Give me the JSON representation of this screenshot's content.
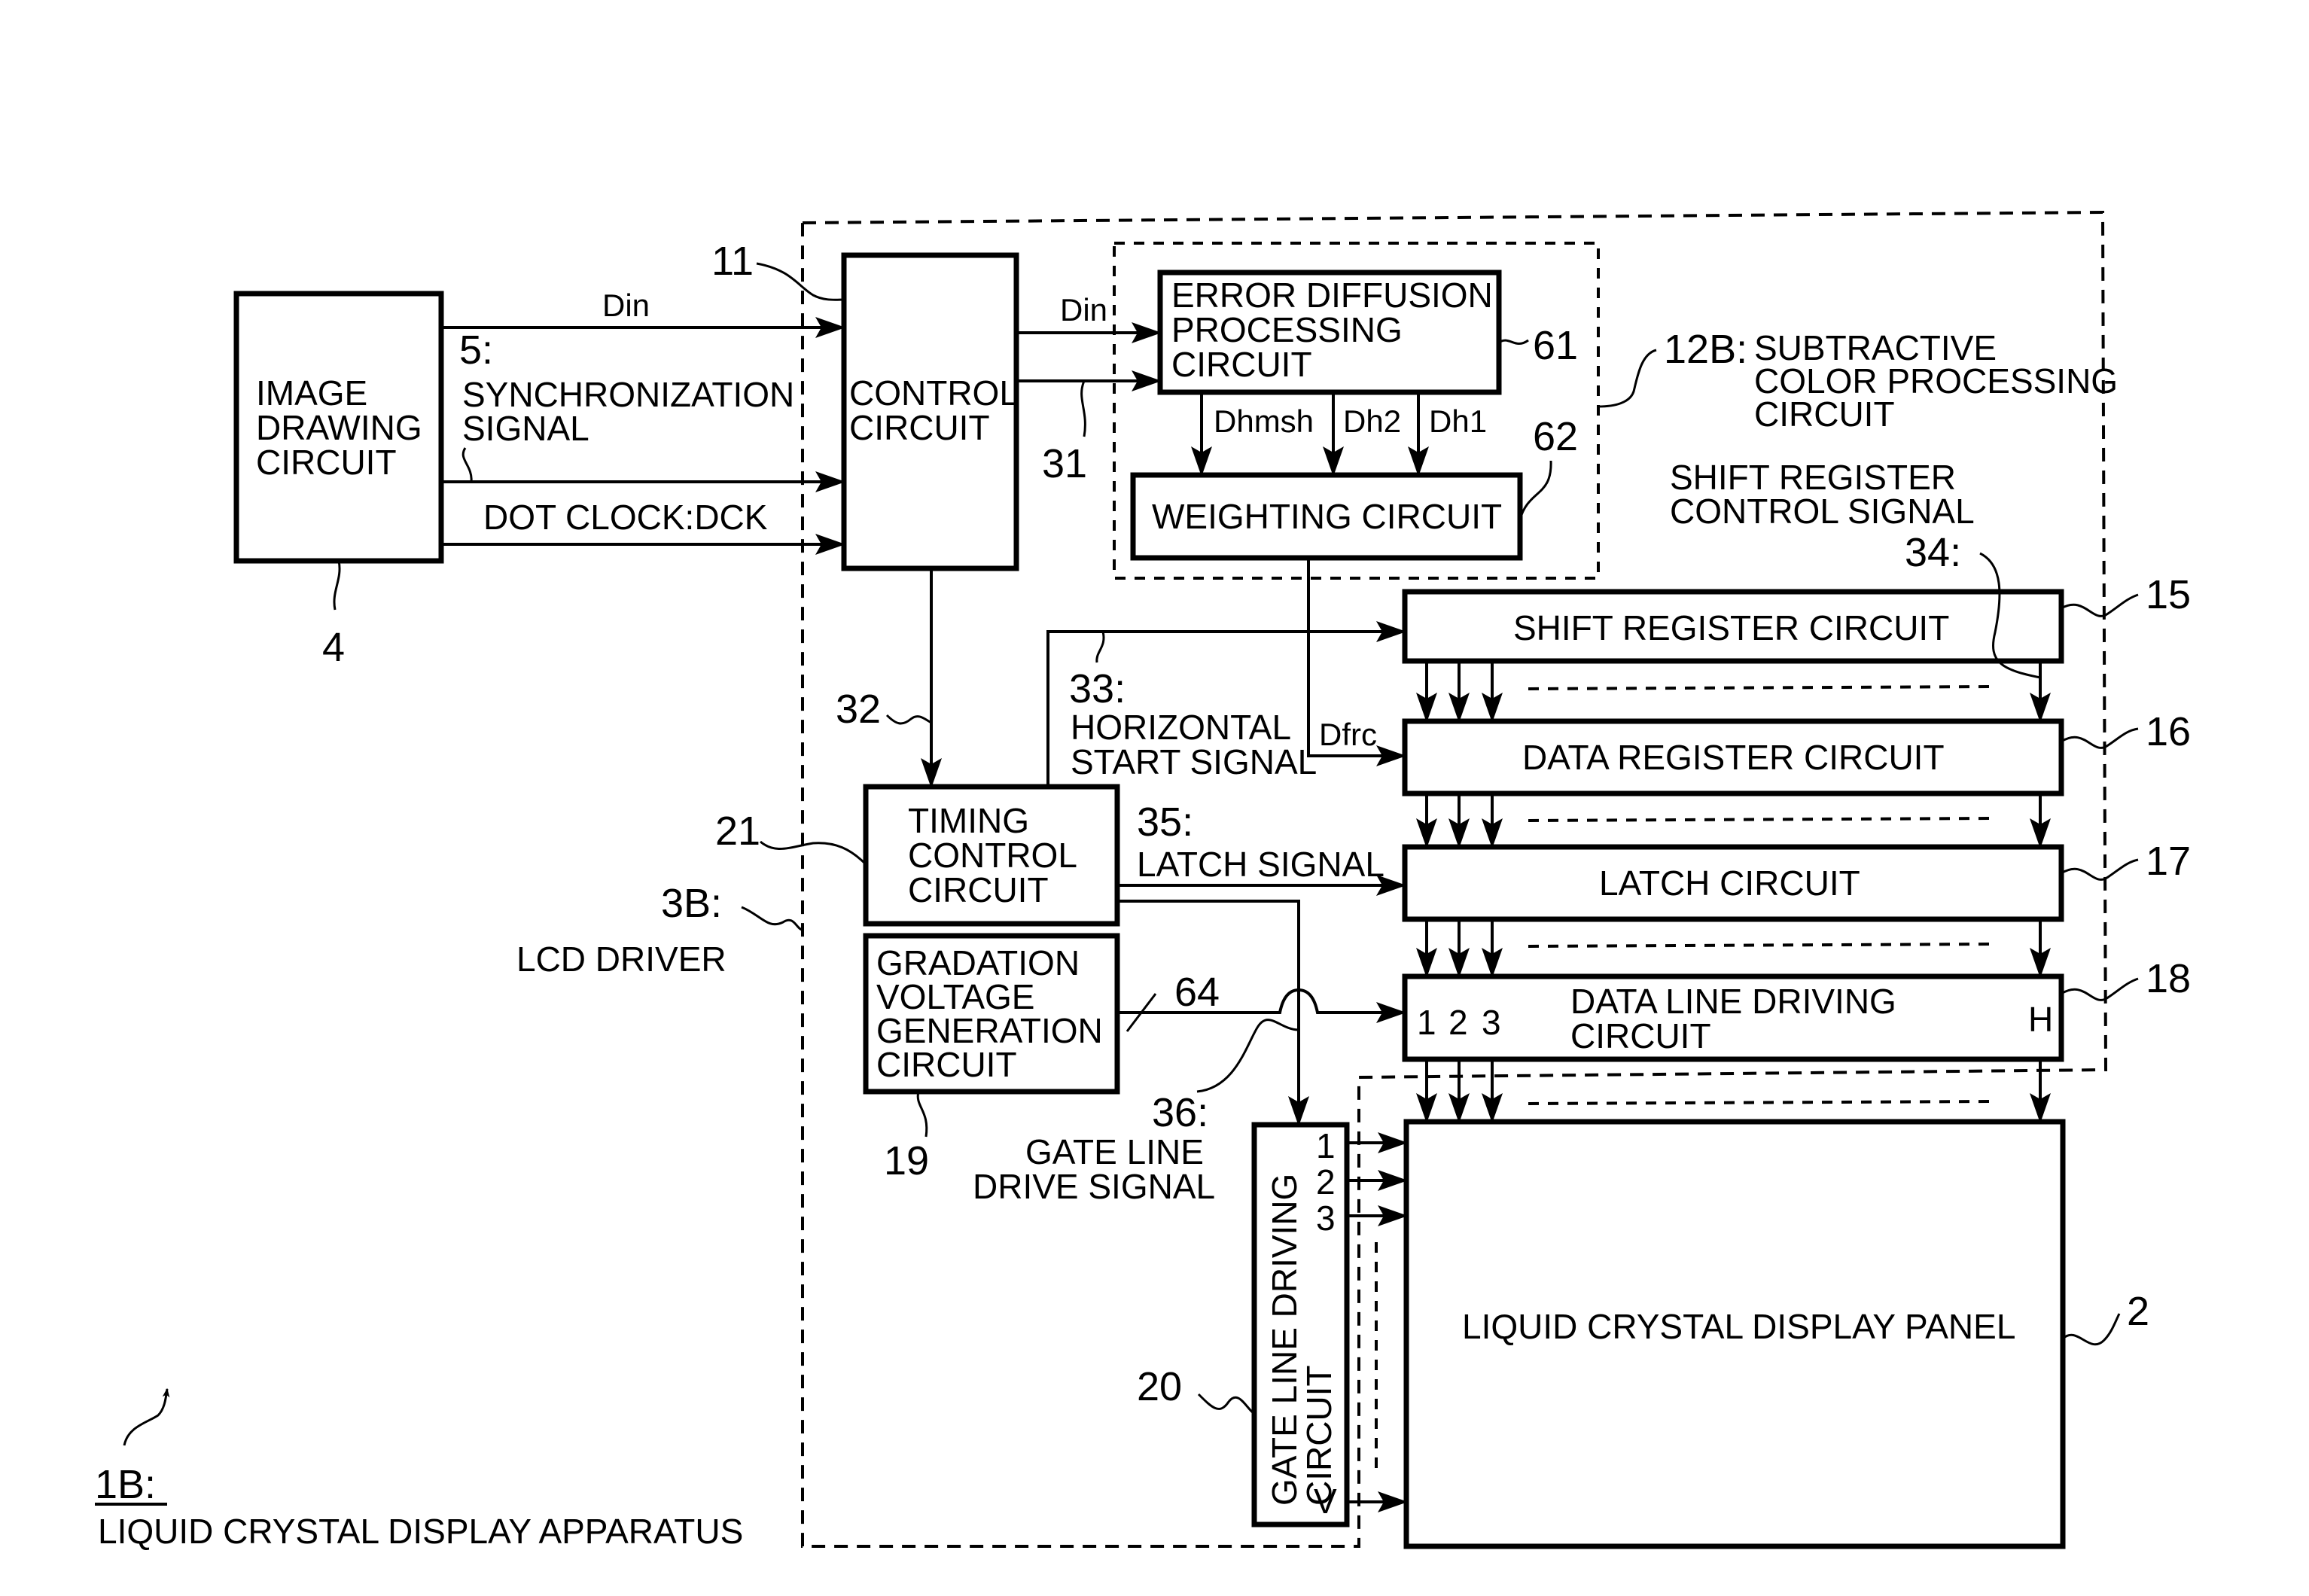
{
  "figure": {
    "apparatus_ref": "1B:",
    "apparatus_label": "LIQUID CRYSTAL DISPLAY APPARATUS",
    "driver_ref": "3B:",
    "driver_label": "LCD DRIVER",
    "subtractive_ref": "12B:",
    "subtractive_label_lines": [
      "SUBTRACTIVE",
      "COLOR PROCESSING",
      "CIRCUIT"
    ]
  },
  "blocks": {
    "image_drawing": {
      "ref": "4",
      "lines": [
        "IMAGE",
        "DRAWING",
        "CIRCUIT"
      ]
    },
    "control": {
      "ref": "11",
      "lines": [
        "CONTROL",
        "CIRCUIT"
      ]
    },
    "error_diffusion": {
      "ref": "61",
      "lines": [
        "ERROR DIFFUSION",
        "PROCESSING",
        "CIRCUIT"
      ]
    },
    "weighting": {
      "ref": "62",
      "lines": [
        "WEIGHTING CIRCUIT"
      ]
    },
    "shift_register": {
      "ref": "15",
      "lines": [
        "SHIFT REGISTER CIRCUIT"
      ]
    },
    "data_register": {
      "ref": "16",
      "lines": [
        "DATA REGISTER CIRCUIT"
      ]
    },
    "latch": {
      "ref": "17",
      "lines": [
        "LATCH CIRCUIT"
      ]
    },
    "data_line_driving": {
      "ref": "18",
      "lines": [
        "DATA LINE DRIVING",
        "CIRCUIT"
      ],
      "ports": [
        "1",
        "2",
        "3"
      ],
      "last_port": "H"
    },
    "timing_control": {
      "ref": "21",
      "lines": [
        "TIMING",
        "CONTROL",
        "CIRCUIT"
      ]
    },
    "gradation_voltage": {
      "ref": "19",
      "lines": [
        "GRADATION",
        "VOLTAGE",
        "GENERATION",
        "CIRCUIT"
      ]
    },
    "gate_line_driving": {
      "ref": "20",
      "lines": [
        "GATE LINE DRIVING",
        "CIRCUIT"
      ],
      "ports": [
        "1",
        "2",
        "3"
      ],
      "last_port": "V"
    },
    "lcd_panel": {
      "ref": "2",
      "lines": [
        "LIQUID CRYSTAL DISPLAY PANEL"
      ]
    }
  },
  "signals": {
    "din_in": "Din",
    "sync_ref": "5:",
    "sync_lines": [
      "SYNCHRONIZATION",
      "SIGNAL"
    ],
    "dot_clock": "DOT CLOCK:DCK",
    "din_out": "Din",
    "ref_31": "31",
    "ref_32": "32",
    "dhmsh": "Dhmsh",
    "dh2": "Dh2",
    "dh1": "Dh1",
    "dfrc": "Dfrc",
    "hstart_ref": "33:",
    "hstart_lines": [
      "HORIZONTAL",
      "START SIGNAL"
    ],
    "shift_ctrl_lines": [
      "SHIFT REGISTER",
      "CONTROL SIGNAL"
    ],
    "shift_ctrl_ref": "34:",
    "latch_ref": "35:",
    "latch_label": "LATCH SIGNAL",
    "ref_64": "64",
    "gate_drive_ref": "36:",
    "gate_drive_lines": [
      "GATE LINE",
      "DRIVE SIGNAL"
    ]
  }
}
